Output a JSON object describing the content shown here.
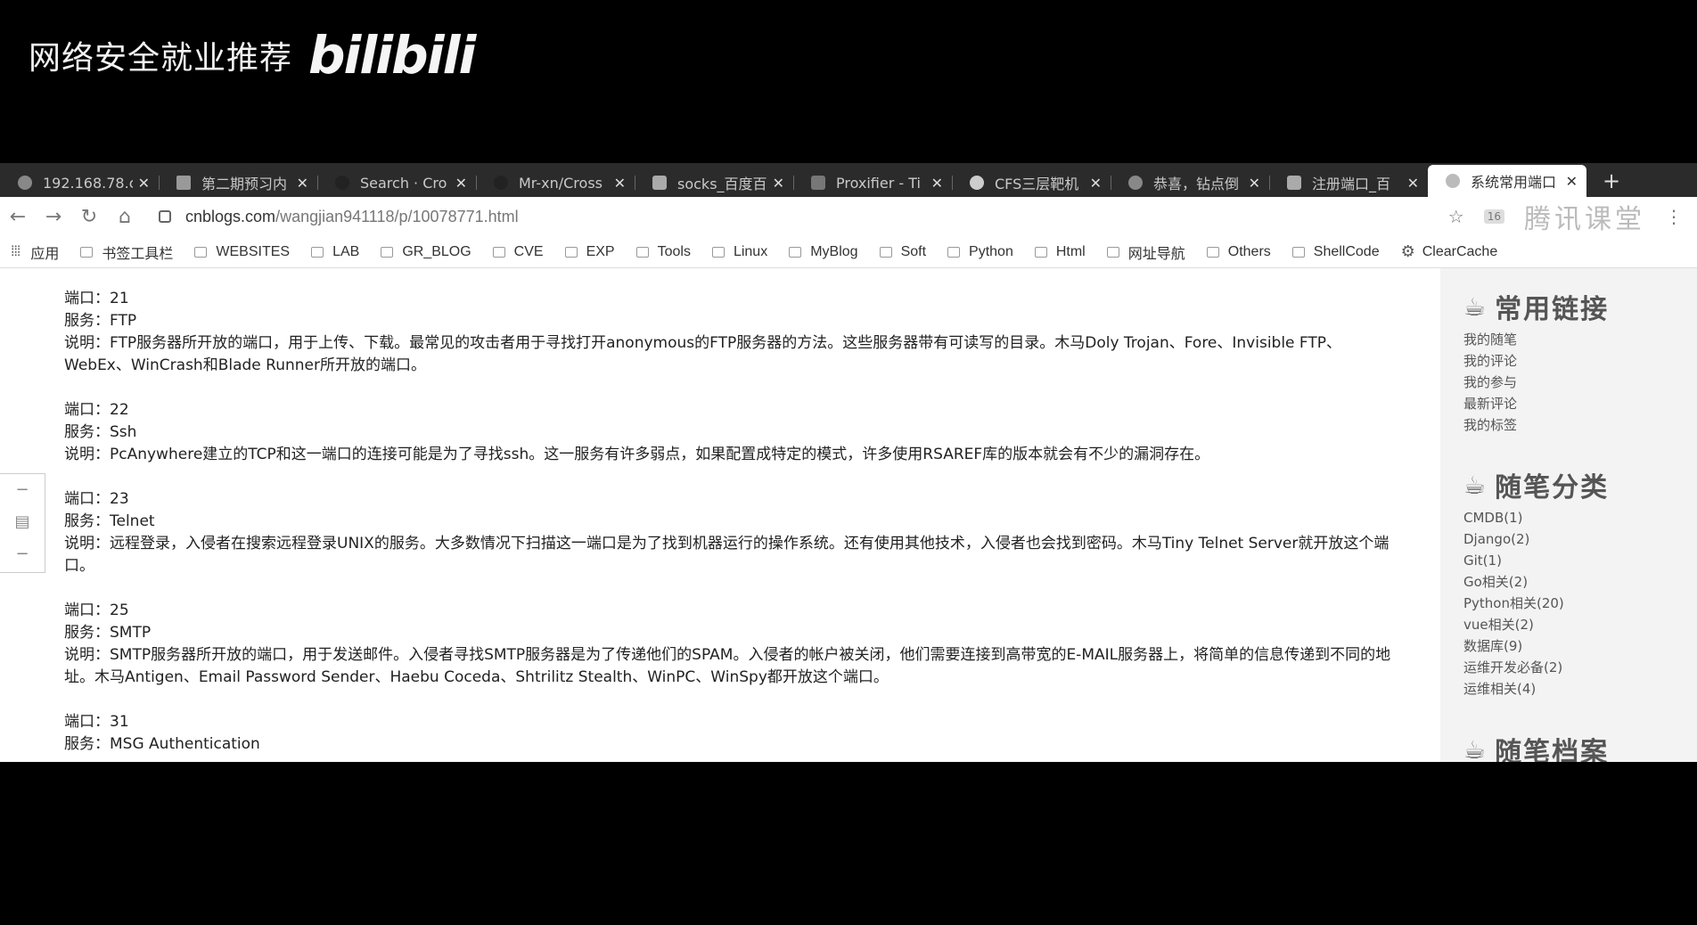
{
  "overlay": {
    "title": "网络安全就业推荐",
    "logo": "bilibili"
  },
  "tabs": [
    {
      "label": "192.168.78.c",
      "icon": "globe-icon"
    },
    {
      "label": "第二期预习内",
      "icon": "doc-icon"
    },
    {
      "label": "Search · Cro",
      "icon": "github-icon"
    },
    {
      "label": "Mr-xn/Cross",
      "icon": "github-icon"
    },
    {
      "label": "socks_百度百",
      "icon": "baidu-icon"
    },
    {
      "label": "Proxifier - Ti",
      "icon": "proxifier-icon"
    },
    {
      "label": "CFS三层靶机",
      "icon": "circle-icon"
    },
    {
      "label": "恭喜，钻点倒",
      "icon": "globe-icon"
    },
    {
      "label": "注册端口_百",
      "icon": "baidu-icon"
    },
    {
      "label": "系统常用端口",
      "icon": "cnblogs-icon",
      "active": true
    }
  ],
  "newtab_label": "+",
  "address": {
    "domain": "cnblogs.com",
    "path": "/wangjian941118/p/10078771.html"
  },
  "toolbar": {
    "star": "☆",
    "badge": "16",
    "watermark": "腾讯课堂"
  },
  "bookmarks": [
    "应用",
    "书签工具栏",
    "WEBSITES",
    "LAB",
    "GR_BLOG",
    "CVE",
    "EXP",
    "Tools",
    "Linux",
    "MyBlog",
    "Soft",
    "Python",
    "Html",
    "网址导航",
    "Others",
    "ShellCode",
    "ClearCache"
  ],
  "ports": [
    {
      "port": "端口：21",
      "service": "服务：FTP",
      "desc": "说明：FTP服务器所开放的端口，用于上传、下载。最常见的攻击者用于寻找打开anonymous的FTP服务器的方法。这些服务器带有可读写的目录。木马Doly Trojan、Fore、Invisible FTP、WebEx、WinCrash和Blade Runner所开放的端口。"
    },
    {
      "port": "端口：22",
      "service": "服务：Ssh",
      "desc": "说明：PcAnywhere建立的TCP和这一端口的连接可能是为了寻找ssh。这一服务有许多弱点，如果配置成特定的模式，许多使用RSAREF库的版本就会有不少的漏洞存在。"
    },
    {
      "port": "端口：23",
      "service": "服务：Telnet",
      "desc": "说明：远程登录，入侵者在搜索远程登录UNIX的服务。大多数情况下扫描这一端口是为了找到机器运行的操作系统。还有使用其他技术，入侵者也会找到密码。木马Tiny Telnet Server就开放这个端口。"
    },
    {
      "port": "端口：25",
      "service": "服务：SMTP",
      "desc": "说明：SMTP服务器所开放的端口，用于发送邮件。入侵者寻找SMTP服务器是为了传递他们的SPAM。入侵者的帐户被关闭，他们需要连接到高带宽的E-MAIL服务器上，将简单的信息传递到不同的地址。木马Antigen、Email Password Sender、Haebu Coceda、Shtrilitz Stealth、WinPC、WinSpy都开放这个端口。"
    },
    {
      "port": "端口：31",
      "service": "服务：MSG Authentication",
      "desc": ""
    }
  ],
  "sidebar": {
    "links_title": "常用链接",
    "links": [
      "我的随笔",
      "我的评论",
      "我的参与",
      "最新评论",
      "我的标签"
    ],
    "cats_title": "随笔分类",
    "cats": [
      "CMDB(1)",
      "Django(2)",
      "Git(1)",
      "Go相关(2)",
      "Python相关(20)",
      "vue相关(2)",
      "数据库(9)",
      "运维开发必备(2)",
      "运维相关(4)"
    ],
    "archive_title": "随笔档案"
  }
}
